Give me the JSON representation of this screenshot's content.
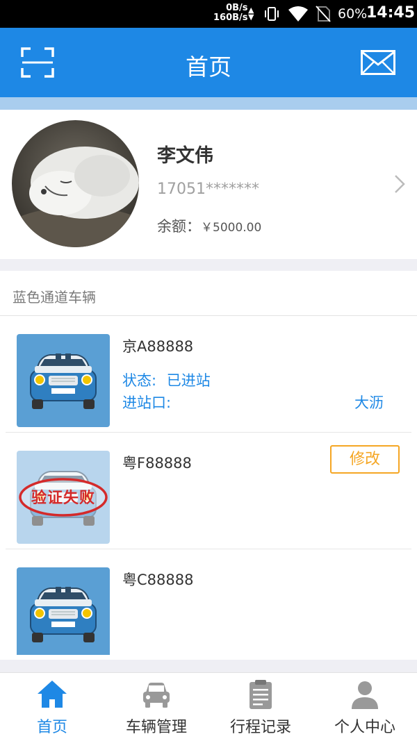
{
  "status_bar": {
    "net_up": "0B/s",
    "net_down": "160B/s",
    "battery": "60%",
    "time": "14:45"
  },
  "nav": {
    "title": "首页",
    "left_icon": "scan-icon",
    "right_icon": "mail-icon"
  },
  "profile": {
    "name": "李文伟",
    "phone": "17051*******",
    "balance_label": "余额：",
    "balance_value": "￥5000.00"
  },
  "vehicles": {
    "section_title": "蓝色通道车辆",
    "items": [
      {
        "plate": "京A88888",
        "status_label": "状态:",
        "status_value": "已进站",
        "station_label": "进站口:",
        "station_value": "大沥"
      },
      {
        "plate": "粤F88888",
        "stamp_text": "验证失败",
        "edit_label": "修改"
      },
      {
        "plate": "粤C88888"
      }
    ]
  },
  "tabs": [
    {
      "label": "首页",
      "icon": "home-icon",
      "active": true
    },
    {
      "label": "车辆管理",
      "icon": "car-icon",
      "active": false
    },
    {
      "label": "行程记录",
      "icon": "clipboard-icon",
      "active": false
    },
    {
      "label": "个人中心",
      "icon": "person-icon",
      "active": false
    }
  ],
  "colors": {
    "primary": "#1e88e5",
    "warning": "#f5a623",
    "stamp": "#d42a2a"
  }
}
